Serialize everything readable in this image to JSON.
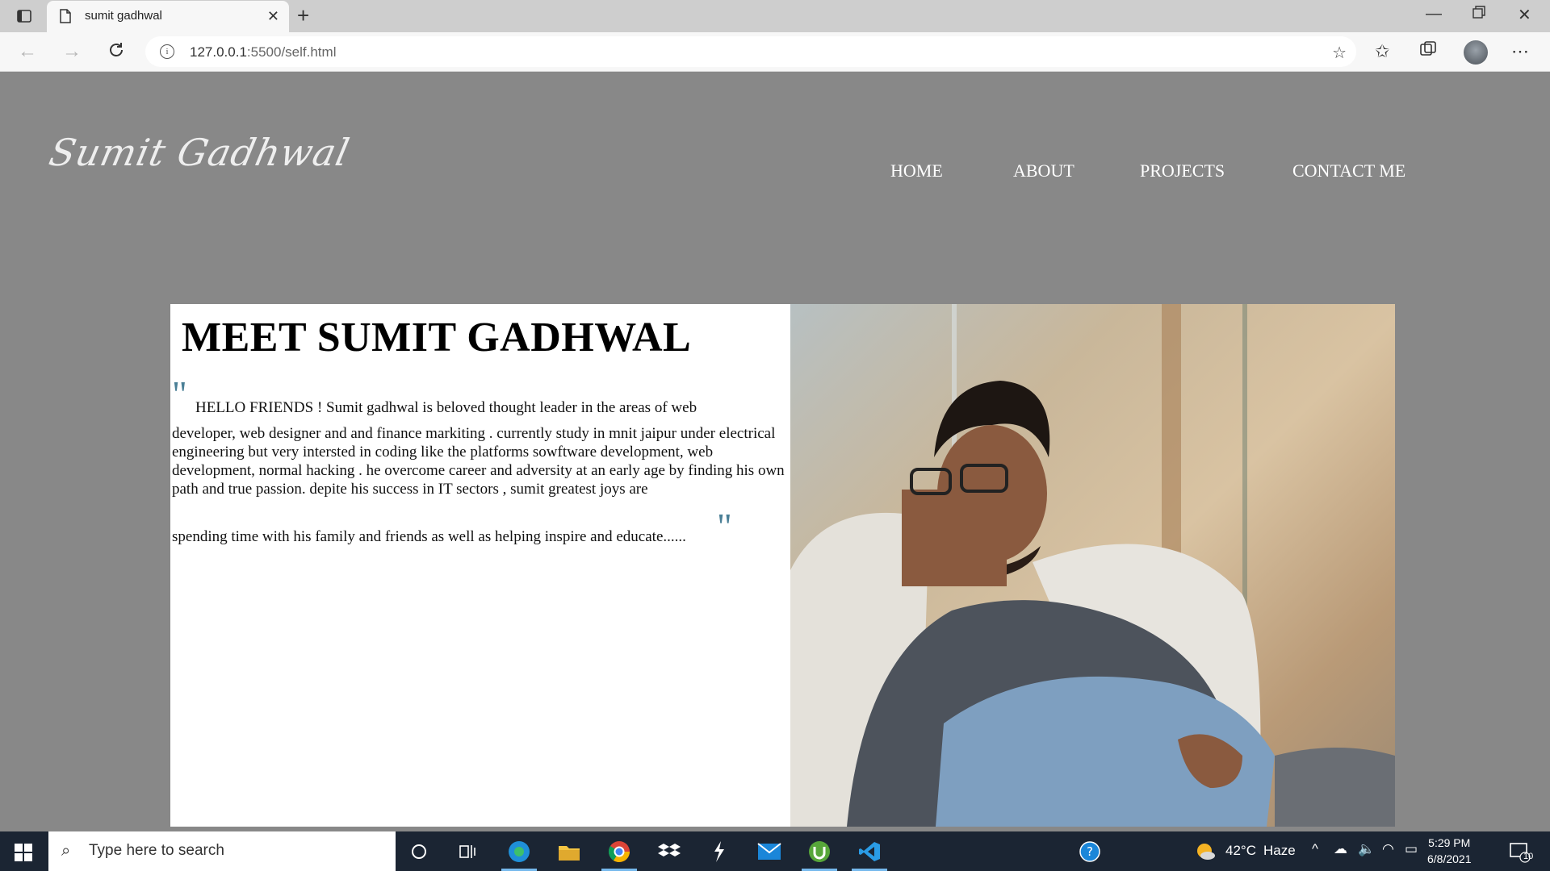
{
  "browser": {
    "tab_title": "sumit gadhwal",
    "url_host": "127.0.0.1",
    "url_rest": ":5500/self.html"
  },
  "site": {
    "logo_text": "Sumit Gadhwal",
    "nav": [
      "HOME",
      "ABOUT",
      "PROJECTS",
      "CONTACT ME"
    ]
  },
  "about": {
    "headline": "MEET SUMIT GADHWAL",
    "quote_open": "\"",
    "quote_close": "\"",
    "para_first": "HELLO FRIENDS ! Sumit gadhwal is beloved thought leader in the areas of web",
    "para_middle": "developer, web designer and and finance markiting . currently study in mnit jaipur under electrical engineering but very intersted in coding like the platforms sowftware development, web development, normal hacking . he overcome career and adversity at an early age by finding his own path and true passion. depite his success in IT sectors , sumit greatest joys are",
    "para_last": "spending time with his family and friends as well as helping inspire and educate......"
  },
  "taskbar": {
    "search_placeholder": "Type here to search",
    "weather_temp": "42°C",
    "weather_desc": "Haze",
    "time": "5:29 PM",
    "date": "6/8/2021",
    "notification_count": "10"
  },
  "colors": {
    "page_bg": "#888888",
    "quote_accent": "#4a7f96",
    "taskbar_bg": "#1b2533"
  }
}
